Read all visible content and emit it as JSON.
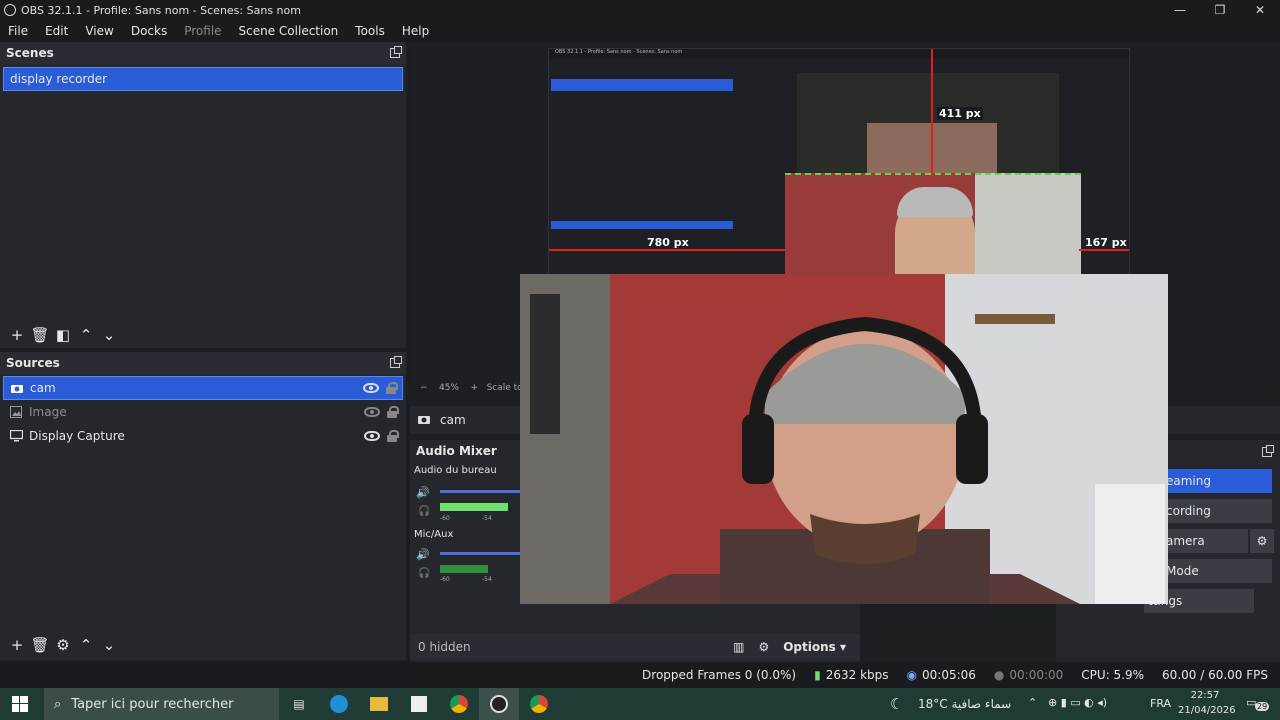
{
  "window": {
    "title": "OBS 32.1.1 - Profile: Sans nom - Scenes: Sans nom",
    "minimize": "—",
    "restore": "❐",
    "close": "✕"
  },
  "menu": [
    "File",
    "Edit",
    "View",
    "Docks",
    "Profile",
    "Scene Collection",
    "Tools",
    "Help"
  ],
  "scenes": {
    "title": "Scenes",
    "items": [
      {
        "label": "display recorder"
      }
    ]
  },
  "sources": {
    "title": "Sources",
    "items": [
      {
        "label": "cam",
        "icon": "camera-icon",
        "visible": true
      },
      {
        "label": "Image",
        "icon": "image-icon",
        "visible": false
      },
      {
        "label": "Display Capture",
        "icon": "monitor-icon",
        "visible": true
      }
    ]
  },
  "preview": {
    "zoom": "45%",
    "scale_label": "Scale to",
    "measure_top": "411 px",
    "measure_left": "780 px",
    "measure_right": "167 px",
    "measure_top_right": "167 px",
    "nested_title": "OBS 32.1.1 - Profile: Sans nom - Scenes: Sans nom"
  },
  "context_bar": {
    "source_name": "cam",
    "hidden_label": "0 hidden",
    "options_label": "Options"
  },
  "mixer": {
    "title": "Audio Mixer",
    "channels": [
      {
        "name": "Audio du bureau",
        "scale_min": "-60",
        "scale_mid": "-54",
        "level": 0.85
      },
      {
        "name": "Mic/Aux",
        "scale_min": "-60",
        "scale_mid": "-54",
        "level": 0.6
      }
    ]
  },
  "controls": {
    "streaming": "eaming",
    "recording": "cording",
    "camera": "amera",
    "mode": "Mode",
    "settings": "ttings"
  },
  "status": {
    "dropped": "Dropped Frames 0 (0.0%)",
    "kbps": "2632 kbps",
    "stream_time": "00:05:06",
    "rec_time": "00:00:00",
    "cpu": "CPU: 5.9%",
    "fps": "60.00 / 60.00 FPS"
  },
  "taskbar": {
    "search_placeholder": "Taper ici pour rechercher",
    "weather": "18°C  سماء صافية",
    "lang": "FRA",
    "time": "22:57",
    "date": "21/04/2026",
    "notif_count": "29"
  },
  "colors": {
    "accent": "#2a5cd8",
    "meter_green": "#6ee06e",
    "guide_red": "#e0201e"
  }
}
